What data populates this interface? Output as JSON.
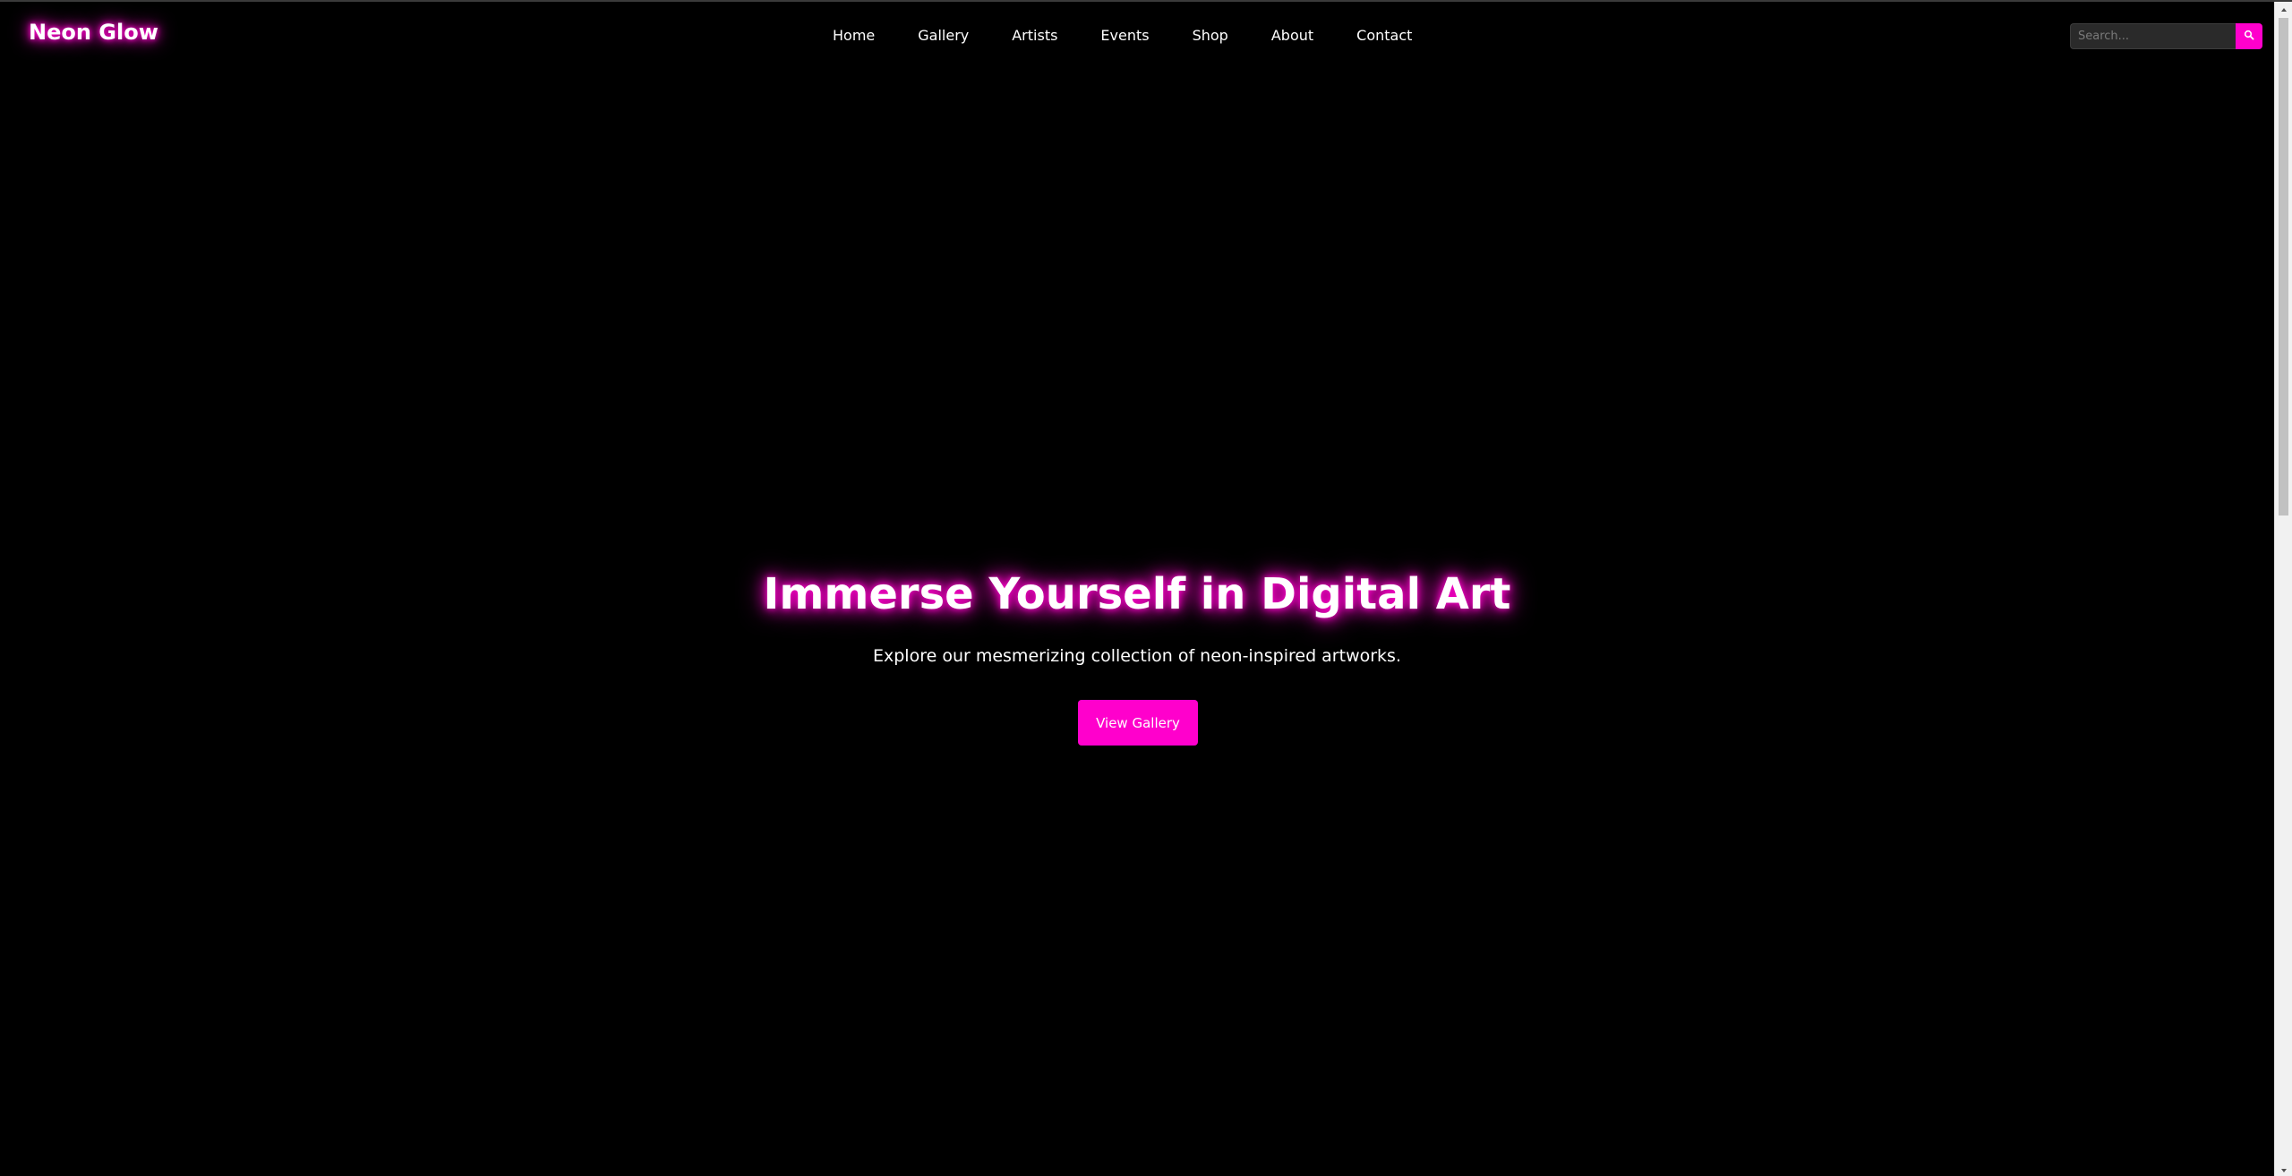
{
  "site": {
    "logo_text": "Neon Glow",
    "accent_color": "#ff00cc",
    "background_color": "#000000"
  },
  "nav": {
    "items": [
      {
        "label": "Home"
      },
      {
        "label": "Gallery"
      },
      {
        "label": "Artists"
      },
      {
        "label": "Events"
      },
      {
        "label": "Shop"
      },
      {
        "label": "About"
      },
      {
        "label": "Contact"
      }
    ]
  },
  "search": {
    "placeholder": "Search...",
    "value": "",
    "button_icon": "search-icon"
  },
  "hero": {
    "title": "Immerse Yourself in Digital Art",
    "subtitle": "Explore our mesmerizing collection of neon-inspired artworks.",
    "cta_label": "View Gallery"
  },
  "scrollbar": {
    "up_icon": "scroll-up-arrow-icon",
    "down_icon": "scroll-down-arrow-icon"
  }
}
